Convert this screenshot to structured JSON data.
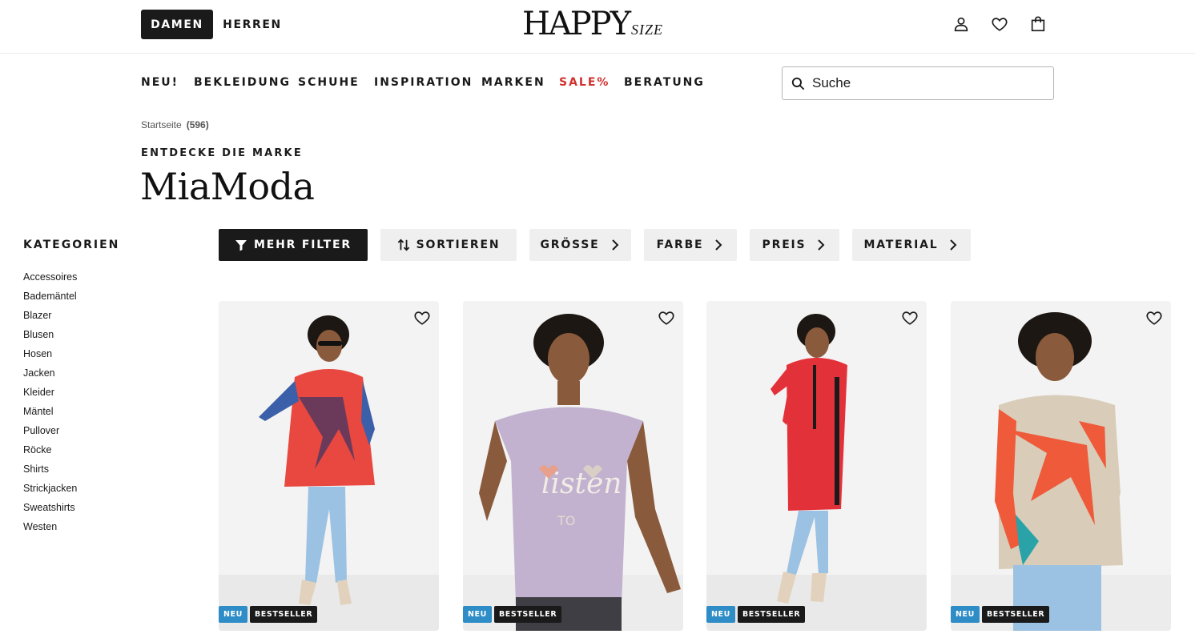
{
  "header": {
    "gender_tabs": [
      "DAMEN",
      "HERREN"
    ],
    "logo_main": "HAPPY",
    "logo_sub": "SIZE",
    "icons": [
      "account-icon",
      "wishlist-heart-icon",
      "shopping-bag-icon"
    ]
  },
  "nav": {
    "items": [
      "NEU!",
      "BEKLEIDUNG",
      "SCHUHE",
      "INSPIRATION",
      "MARKEN",
      "SALE%",
      "BERATUNG"
    ],
    "sale_color": "#d0312d",
    "search_placeholder": "Suche"
  },
  "breadcrumb": {
    "home": "Startseite",
    "count": "(596)"
  },
  "brand": {
    "kicker": "ENTDECKE DIE MARKE",
    "title": "MiaModa"
  },
  "sidebar": {
    "heading": "KATEGORIEN",
    "categories": [
      "Accessoires",
      "Bademäntel",
      "Blazer",
      "Blusen",
      "Hosen",
      "Jacken",
      "Kleider",
      "Mäntel",
      "Pullover",
      "Röcke",
      "Shirts",
      "Strickjacken",
      "Sweatshirts",
      "Westen"
    ]
  },
  "filters": {
    "more": "MEHR FILTER",
    "sort": "SORTIEREN",
    "size": "GRÖSSE",
    "color": "FARBE",
    "price": "PREIS",
    "material": "MATERIAL"
  },
  "products": [
    {
      "badges": [
        "NEU",
        "BESTSELLER"
      ],
      "top_color": "#e8483f",
      "bottom_color": "#9cc2e3",
      "hair": "#1c1712"
    },
    {
      "badges": [
        "NEU",
        "BESTSELLER"
      ],
      "top_color": "#c2b2cf",
      "bottom_color": "#3e3e44",
      "hair": "#1c1712"
    },
    {
      "badges": [
        "NEU",
        "BESTSELLER"
      ],
      "top_color": "#e3313a",
      "bottom_color": "#9cc2e3",
      "hair": "#1c1712"
    },
    {
      "badges": [
        "NEU",
        "BESTSELLER"
      ],
      "top_color": "#d9cdb9",
      "bottom_color": "#9cc2e3",
      "hair": "#1c1712"
    }
  ],
  "colors": {
    "accent_dark": "#1a1a1a",
    "badge_neu": "#2e8dc6",
    "filter_bg": "#efefef"
  }
}
